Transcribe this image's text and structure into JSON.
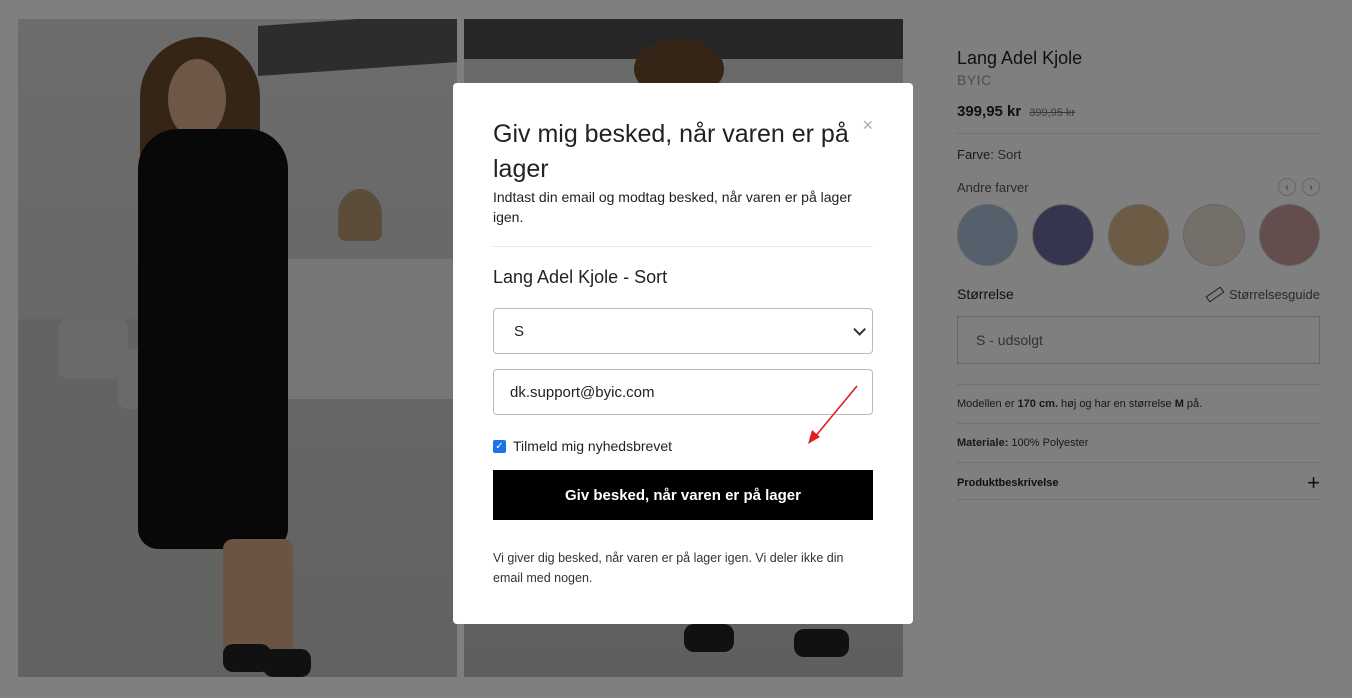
{
  "product": {
    "title": "Lang Adel Kjole",
    "brand": "BYIC",
    "price": "399,95 kr",
    "old_price": "399,95 kr",
    "color_label": "Farve:",
    "color_value": "Sort",
    "other_colors_label": "Andre farver",
    "size_label": "Størrelse",
    "size_guide_label": "Størrelsesguide",
    "size_selected": "S - udsolgt",
    "model_info_prefix": "Modellen er ",
    "model_height": "170 cm.",
    "model_info_middle": " høj og har en størrelse ",
    "model_size": "M",
    "model_info_suffix": " på.",
    "material_label": "Materiale:",
    "material_value": "100% Polyester",
    "description_label": "Produktbeskrivelse",
    "swatch_colors": [
      "#a9c0d8",
      "#6c6aa0",
      "#d9b98c",
      "#e8dfd2",
      "#c89a9a"
    ]
  },
  "modal": {
    "title": "Giv mig besked, når varen er på lager",
    "close": "×",
    "subtitle": "Indtast din email og modtag besked, når varen er på lager igen.",
    "product_name": "Lang Adel Kjole - Sort",
    "size_select_value": "S",
    "email_value": "dk.support@byic.com",
    "newsletter_label": "Tilmeld mig nyhedsbrevet",
    "newsletter_checked": true,
    "cta_label": "Giv besked, når varen er på lager",
    "disclaimer": "Vi giver dig besked, når varen er på lager igen. Vi deler ikke din email med nogen."
  },
  "colors": {
    "overlay": "rgba(0,0,0,0.5)",
    "cta_bg": "#000000",
    "checkbox": "#1a73e8",
    "annotation_arrow": "#e02020"
  }
}
